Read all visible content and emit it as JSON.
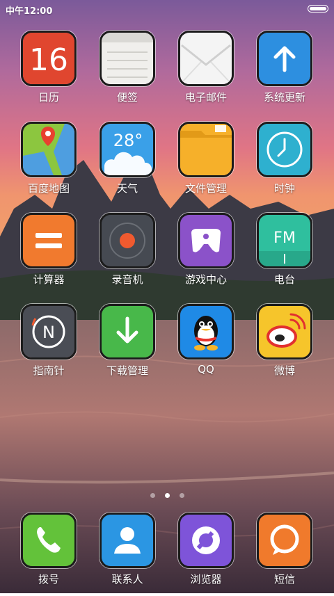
{
  "status_bar": {
    "time": "中午12:00"
  },
  "pages": {
    "count": 3,
    "active": 1
  },
  "apps": [
    {
      "label": "日历",
      "icon": "calendar-icon",
      "value": "16"
    },
    {
      "label": "便签",
      "icon": "notes-icon"
    },
    {
      "label": "电子邮件",
      "icon": "mail-icon"
    },
    {
      "label": "系统更新",
      "icon": "update-arrow-icon"
    },
    {
      "label": "百度地图",
      "icon": "map-pin-icon"
    },
    {
      "label": "天气",
      "icon": "weather-cloud-icon",
      "value": "28°"
    },
    {
      "label": "文件管理",
      "icon": "folder-icon"
    },
    {
      "label": "时钟",
      "icon": "clock-icon"
    },
    {
      "label": "计算器",
      "icon": "calculator-icon"
    },
    {
      "label": "录音机",
      "icon": "recorder-icon"
    },
    {
      "label": "游戏中心",
      "icon": "gamepad-icon"
    },
    {
      "label": "电台",
      "icon": "radio-icon",
      "value": "FM"
    },
    {
      "label": "指南针",
      "icon": "compass-icon",
      "value": "N"
    },
    {
      "label": "下载管理",
      "icon": "download-icon"
    },
    {
      "label": "QQ",
      "icon": "qq-penguin-icon"
    },
    {
      "label": "微博",
      "icon": "weibo-icon"
    }
  ],
  "dock": [
    {
      "label": "拨号",
      "icon": "phone-icon"
    },
    {
      "label": "联系人",
      "icon": "contacts-icon"
    },
    {
      "label": "浏览器",
      "icon": "browser-icon"
    },
    {
      "label": "短信",
      "icon": "message-icon"
    }
  ]
}
